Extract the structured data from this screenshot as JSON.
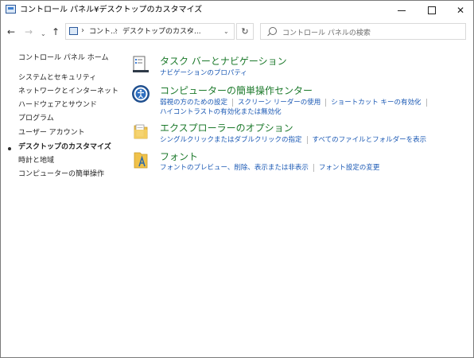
{
  "window": {
    "title": "コントロール パネル¥デスクトップのカスタマイズ",
    "controls": {
      "minimize": "",
      "maximize": "",
      "close": "✕"
    }
  },
  "address": {
    "crumbs": [
      "コント...",
      "デスクトップのカスタ..."
    ],
    "separator": "›",
    "refresh": "↻",
    "search_placeholder": "コントロール パネルの検索"
  },
  "nav": {
    "back": "←",
    "forward": "→",
    "recent": "⌄",
    "up": "↑"
  },
  "sidebar": {
    "items": [
      {
        "label": "コントロール パネル ホーム"
      },
      {
        "label": "システムとセキュリティ"
      },
      {
        "label": "ネットワークとインターネット"
      },
      {
        "label": "ハードウェアとサウンド"
      },
      {
        "label": "プログラム"
      },
      {
        "label": "ユーザー アカウント"
      },
      {
        "label": "デスクトップのカスタマイズ",
        "active": true
      },
      {
        "label": "時計と地域"
      },
      {
        "label": "コンピューターの簡単操作"
      }
    ]
  },
  "categories": [
    {
      "title": "タスク バーとナビゲーション",
      "icon": "taskbar-icon",
      "links": [
        [
          "ナビゲーションのプロパティ"
        ]
      ]
    },
    {
      "title": "コンピューターの簡単操作センター",
      "icon": "ease-of-access-icon",
      "links": [
        [
          "弱視の方のための設定",
          "スクリーン リーダーの使用",
          "ショートカット キーの有効化"
        ],
        [
          "ハイコントラストの有効化または無効化"
        ]
      ]
    },
    {
      "title": "エクスプローラーのオプション",
      "icon": "folder-options-icon",
      "links": [
        [
          "シングルクリックまたはダブルクリックの指定",
          "すべてのファイルとフォルダーを表示"
        ]
      ]
    },
    {
      "title": "フォント",
      "icon": "fonts-icon",
      "links": [
        [
          "フォントのプレビュー、削除、表示または非表示",
          "フォント設定の変更"
        ]
      ]
    }
  ]
}
